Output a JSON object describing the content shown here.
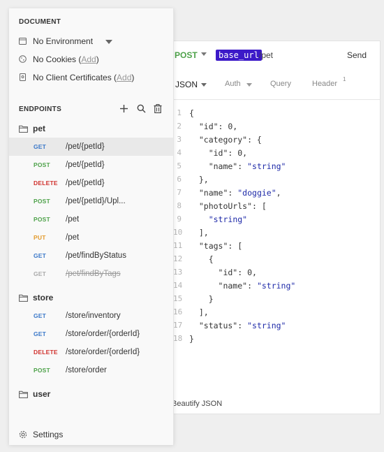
{
  "colors": {
    "get": "#3a78c9",
    "post": "#4ea24a",
    "delete": "#d0312d",
    "put": "#e39a2c",
    "deprecated": "#aaaaaa",
    "accent": "#3c19c8"
  },
  "sidebar": {
    "document_label": "DOCUMENT",
    "environment": {
      "label": "No Environment",
      "icon": "calendar-icon"
    },
    "cookies": {
      "prefix": "No Cookies (",
      "link": "Add",
      "suffix": ")",
      "icon": "cookie-icon"
    },
    "certificates": {
      "prefix": "No Client Certificates (",
      "link": "Add",
      "suffix": ")",
      "icon": "certificate-icon"
    },
    "endpoints_label": "ENDPOINTS",
    "folders": [
      {
        "name": "pet",
        "endpoints": [
          {
            "method": "GET",
            "path": "/pet/{petId}"
          },
          {
            "method": "POST",
            "path": "/pet/{petId}"
          },
          {
            "method": "DELETE",
            "path": "/pet/{petId}"
          },
          {
            "method": "POST",
            "path": "/pet/{petId}/Upl..."
          },
          {
            "method": "POST",
            "path": "/pet"
          },
          {
            "method": "PUT",
            "path": "/pet"
          },
          {
            "method": "GET",
            "path": "/pet/findByStatus"
          },
          {
            "method": "GET",
            "path": "/pet/findByTags"
          }
        ]
      },
      {
        "name": "store",
        "endpoints": [
          {
            "method": "GET",
            "path": "/store/inventory"
          },
          {
            "method": "GET",
            "path": "/store/order/{orderId}"
          },
          {
            "method": "DELETE",
            "path": "/store/order/{orderId}"
          },
          {
            "method": "POST",
            "path": "/store/order"
          }
        ]
      },
      {
        "name": "user",
        "endpoints": []
      }
    ],
    "settings_label": "Settings"
  },
  "request": {
    "method": "POST",
    "base_url": "base_url",
    "path": "/pet",
    "send_label": "Send",
    "tabs": {
      "json": "JSON",
      "auth": "Auth",
      "query": "Query",
      "header": "Header",
      "header_count": "1"
    },
    "body_lines": [
      "{",
      "  \"id\": 0,",
      "  \"category\": {",
      "    \"id\": 0,",
      "    \"name\": \"string\"",
      "  },",
      "  \"name\": \"doggie\",",
      "  \"photoUrls\": [",
      "    \"string\"",
      "  ],",
      "  \"tags\": [",
      "    {",
      "      \"id\": 0,",
      "      \"name\": \"string\"",
      "    }",
      "  ],",
      "  \"status\": \"string\"",
      "}"
    ],
    "beautify_label": "Beautify JSON"
  }
}
